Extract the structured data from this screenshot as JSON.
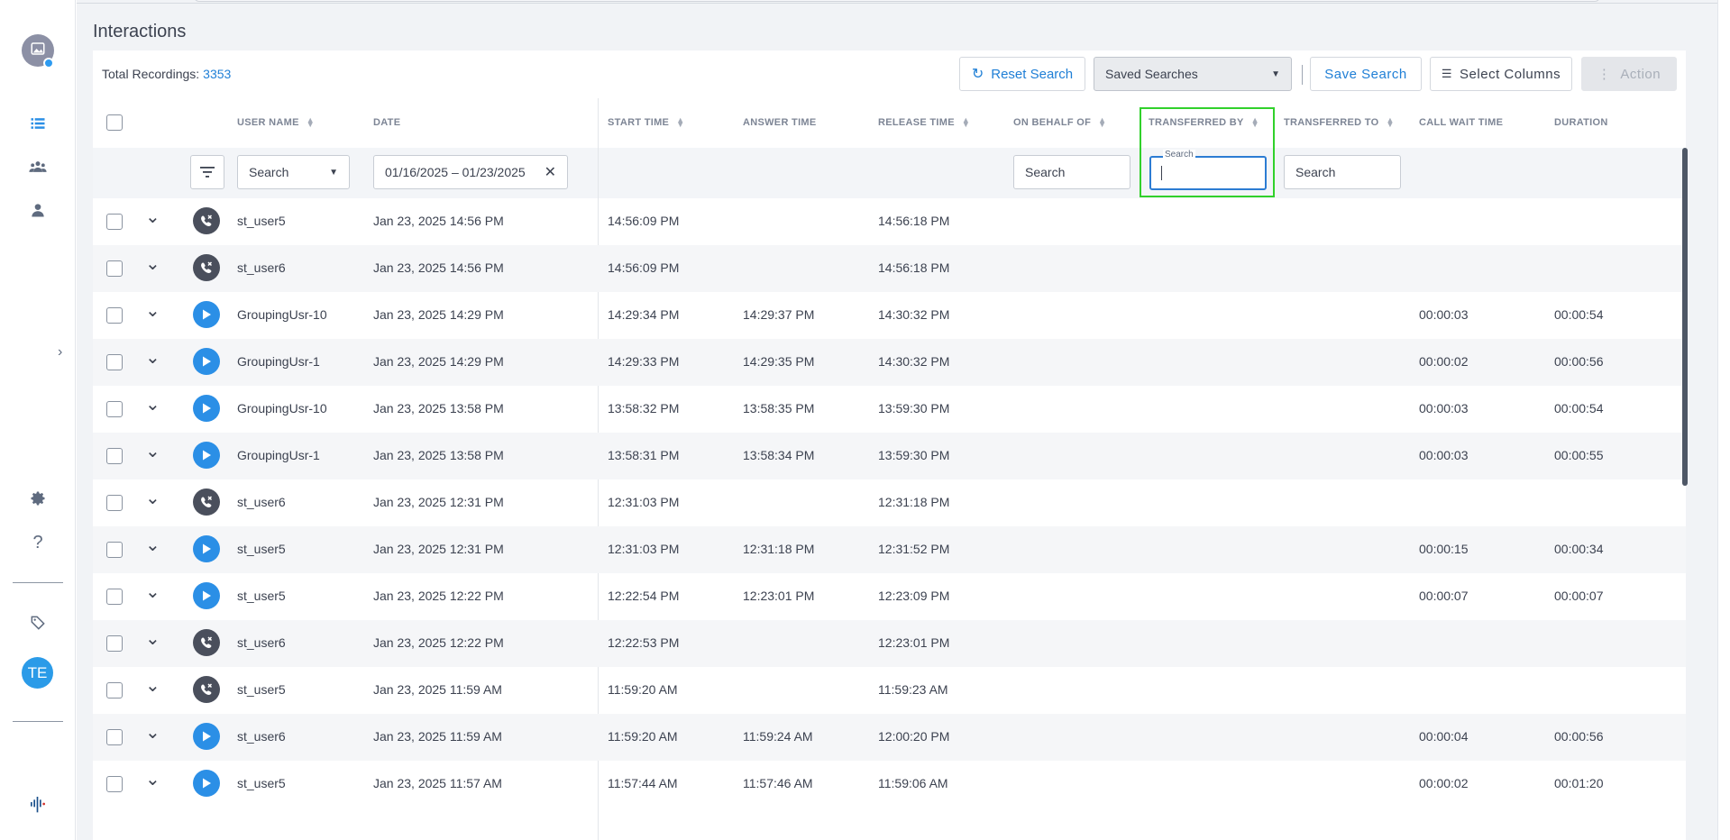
{
  "page": {
    "title": "Interactions",
    "total_label": "Total Recordings:",
    "total_value": "3353"
  },
  "toolbar": {
    "reset_label": "Reset Search",
    "saved_searches_label": "Saved Searches",
    "save_label": "Save Search",
    "select_columns_label": "Select Columns",
    "action_label": "Action"
  },
  "sidebar": {
    "user_initials": "TE",
    "icons": [
      "image-icon",
      "list-icon",
      "group-icon",
      "person-icon",
      "gear-icon",
      "help-icon",
      "tag-icon",
      "logo-icon"
    ]
  },
  "columns": {
    "user_name": "USER NAME",
    "date": "DATE",
    "start_time": "START TIME",
    "answer_time": "ANSWER TIME",
    "release_time": "RELEASE TIME",
    "on_behalf_of": "ON BEHALF OF",
    "transferred_by": "TRANSFERRED BY",
    "transferred_to": "TRANSFERRED TO",
    "call_wait_time": "CALL WAIT TIME",
    "duration": "DURATION"
  },
  "filters": {
    "user_select": "Search",
    "date_range": "01/16/2025 – 01/23/2025",
    "on_behalf_placeholder": "Search",
    "transferred_by_label": "Search",
    "transferred_to_placeholder": "Search"
  },
  "rows": [
    {
      "type": "missed",
      "user": "st_user5",
      "date": "Jan 23, 2025 14:56 PM",
      "start": "14:56:09 PM",
      "answer": "",
      "release": "14:56:18 PM",
      "wait": "",
      "duration": ""
    },
    {
      "type": "missed",
      "user": "st_user6",
      "date": "Jan 23, 2025 14:56 PM",
      "start": "14:56:09 PM",
      "answer": "",
      "release": "14:56:18 PM",
      "wait": "",
      "duration": ""
    },
    {
      "type": "play",
      "user": "GroupingUsr-10",
      "date": "Jan 23, 2025 14:29 PM",
      "start": "14:29:34 PM",
      "answer": "14:29:37 PM",
      "release": "14:30:32 PM",
      "wait": "00:00:03",
      "duration": "00:00:54"
    },
    {
      "type": "play",
      "user": "GroupingUsr-1",
      "date": "Jan 23, 2025 14:29 PM",
      "start": "14:29:33 PM",
      "answer": "14:29:35 PM",
      "release": "14:30:32 PM",
      "wait": "00:00:02",
      "duration": "00:00:56"
    },
    {
      "type": "play",
      "user": "GroupingUsr-10",
      "date": "Jan 23, 2025 13:58 PM",
      "start": "13:58:32 PM",
      "answer": "13:58:35 PM",
      "release": "13:59:30 PM",
      "wait": "00:00:03",
      "duration": "00:00:54"
    },
    {
      "type": "play",
      "user": "GroupingUsr-1",
      "date": "Jan 23, 2025 13:58 PM",
      "start": "13:58:31 PM",
      "answer": "13:58:34 PM",
      "release": "13:59:30 PM",
      "wait": "00:00:03",
      "duration": "00:00:55"
    },
    {
      "type": "missed",
      "user": "st_user6",
      "date": "Jan 23, 2025 12:31 PM",
      "start": "12:31:03 PM",
      "answer": "",
      "release": "12:31:18 PM",
      "wait": "",
      "duration": ""
    },
    {
      "type": "play",
      "user": "st_user5",
      "date": "Jan 23, 2025 12:31 PM",
      "start": "12:31:03 PM",
      "answer": "12:31:18 PM",
      "release": "12:31:52 PM",
      "wait": "00:00:15",
      "duration": "00:00:34"
    },
    {
      "type": "play",
      "user": "st_user5",
      "date": "Jan 23, 2025 12:22 PM",
      "start": "12:22:54 PM",
      "answer": "12:23:01 PM",
      "release": "12:23:09 PM",
      "wait": "00:00:07",
      "duration": "00:00:07"
    },
    {
      "type": "missed",
      "user": "st_user6",
      "date": "Jan 23, 2025 12:22 PM",
      "start": "12:22:53 PM",
      "answer": "",
      "release": "12:23:01 PM",
      "wait": "",
      "duration": ""
    },
    {
      "type": "missed",
      "user": "st_user5",
      "date": "Jan 23, 2025 11:59 AM",
      "start": "11:59:20 AM",
      "answer": "",
      "release": "11:59:23 AM",
      "wait": "",
      "duration": ""
    },
    {
      "type": "play",
      "user": "st_user6",
      "date": "Jan 23, 2025 11:59 AM",
      "start": "11:59:20 AM",
      "answer": "11:59:24 AM",
      "release": "12:00:20 PM",
      "wait": "00:00:04",
      "duration": "00:00:56"
    },
    {
      "type": "play",
      "user": "st_user5",
      "date": "Jan 23, 2025 11:57 AM",
      "start": "11:57:44 AM",
      "answer": "11:57:46 AM",
      "release": "11:59:06 AM",
      "wait": "00:00:02",
      "duration": "00:01:20"
    }
  ]
}
